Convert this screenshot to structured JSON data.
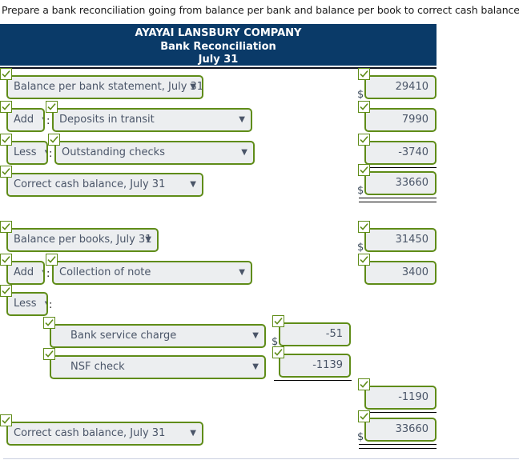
{
  "prompt": "Prepare a bank reconciliation going from balance per bank and balance per book to correct cash balance.",
  "header": {
    "company": "AYAYAI LANSBURY COMPANY",
    "statement": "Bank Reconciliation",
    "date": "July 31"
  },
  "colors": {
    "header_bg": "#0a3a68",
    "field_border": "#5f8c18",
    "field_fill": "#eceef0",
    "text": "#4a5568"
  },
  "symbols": {
    "dollar": "$",
    "colon": ":",
    "caret": "▼",
    "check": "check-icon"
  },
  "bank_section": {
    "rows": [
      {
        "label": "Balance per bank statement, July 31",
        "amount": "29410",
        "show_dollar": true
      },
      {
        "prefix": "Add",
        "label": "Deposits in transit",
        "amount": "7990",
        "show_dollar": false
      },
      {
        "prefix": "Less",
        "label": "Outstanding checks",
        "amount": "-3740",
        "show_dollar": false
      },
      {
        "label": "Correct cash balance, July 31",
        "amount": "33660",
        "show_dollar": true
      }
    ]
  },
  "book_section": {
    "rows": [
      {
        "label": "Balance per books, July 31",
        "amount": "31450",
        "show_dollar": true
      },
      {
        "prefix": "Add",
        "label": "Collection of note",
        "amount": "3400",
        "show_dollar": false
      },
      {
        "prefix": "Less"
      }
    ],
    "deductions": [
      {
        "label": "Bank service charge",
        "amount": "-51",
        "show_dollar": true
      },
      {
        "label": "NSF check",
        "amount": "-1139",
        "show_dollar": false
      }
    ],
    "deductions_total": "-1190",
    "final_row": {
      "label": "Correct cash balance, July 31",
      "amount": "33660",
      "show_dollar": true
    }
  }
}
